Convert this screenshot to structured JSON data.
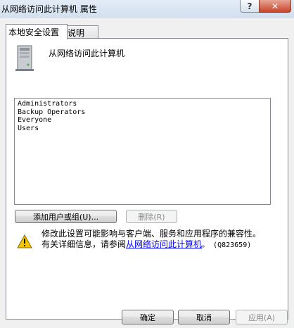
{
  "window": {
    "title": "从网络访问此计算机 属性",
    "help_button": "?",
    "close_button": "✕"
  },
  "tabs": [
    {
      "label": "本地安全设置",
      "active": true
    },
    {
      "label": "说明",
      "active": false
    }
  ],
  "policy": {
    "title": "从网络访问此计算机"
  },
  "members": {
    "items": [
      "Administrators",
      "Backup Operators",
      "Everyone",
      "Users"
    ]
  },
  "actions": {
    "add_label": "添加用户或组(U)...",
    "remove_label": "删除(R)"
  },
  "warning": {
    "line1": "修改此设置可能影响与客户端、服务和应用程序的兼容性。",
    "line2_prefix": "有关详细信息，请参阅",
    "link_text": "从网络访问此计算机",
    "kb": "。 (Q823659)"
  },
  "footer": {
    "ok_label": "确定",
    "cancel_label": "取消",
    "apply_label": "应用(A)"
  },
  "icons": {
    "server": "server-icon",
    "warning": "warning-icon",
    "warning_color": "#f5c400"
  }
}
